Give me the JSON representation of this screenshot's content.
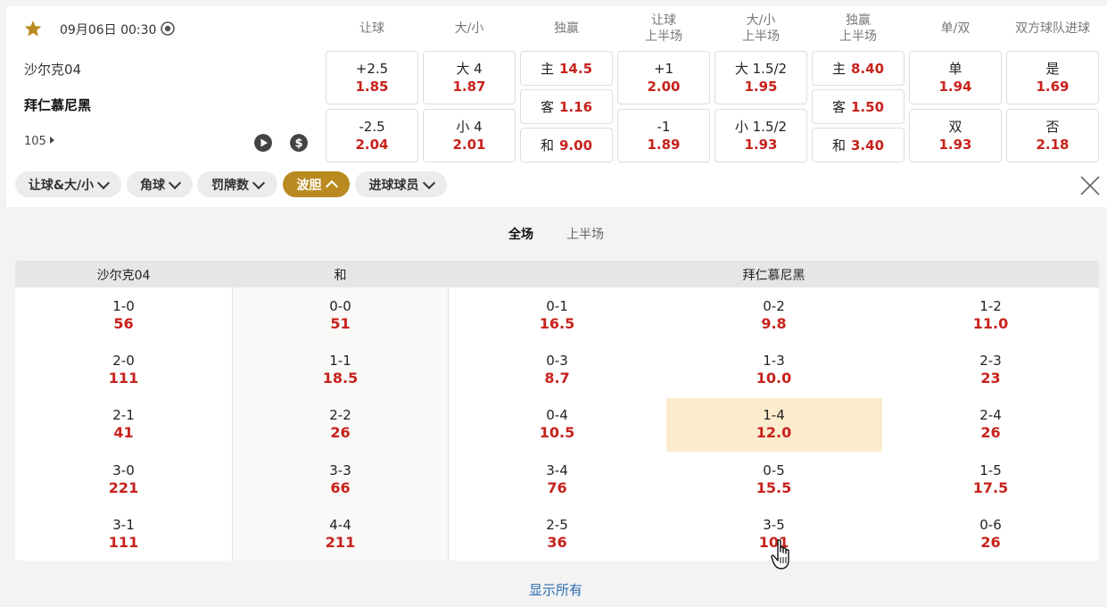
{
  "match": {
    "datetime": "09月06日 00:30",
    "home": "沙尔克04",
    "away": "拜仁慕尼黑",
    "more_count": "105"
  },
  "column_headers": [
    {
      "line1": "让球",
      "line2": ""
    },
    {
      "line1": "大/小",
      "line2": ""
    },
    {
      "line1": "独赢",
      "line2": ""
    },
    {
      "line1": "让球",
      "line2": "上半场"
    },
    {
      "line1": "大/小",
      "line2": "上半场"
    },
    {
      "line1": "独赢",
      "line2": "上半场"
    },
    {
      "line1": "单/双",
      "line2": ""
    },
    {
      "line1": "双方球队进球",
      "line2": ""
    }
  ],
  "markets": {
    "handicap": [
      {
        "label": "+2.5",
        "odds": "1.85"
      },
      {
        "label": "-2.5",
        "odds": "2.04"
      }
    ],
    "over_under": [
      {
        "label": "大 4",
        "odds": "1.87"
      },
      {
        "label": "小 4",
        "odds": "2.01"
      }
    ],
    "win": [
      {
        "label": "主",
        "odds": "14.5"
      },
      {
        "label": "客",
        "odds": "1.16"
      },
      {
        "label": "和",
        "odds": "9.00"
      }
    ],
    "handicap_1h": [
      {
        "label": "+1",
        "odds": "2.00"
      },
      {
        "label": "-1",
        "odds": "1.89"
      }
    ],
    "over_under_1h": [
      {
        "label": "大 1.5/2",
        "odds": "1.95"
      },
      {
        "label": "小 1.5/2",
        "odds": "1.93"
      }
    ],
    "win_1h": [
      {
        "label": "主",
        "odds": "8.40"
      },
      {
        "label": "客",
        "odds": "1.50"
      },
      {
        "label": "和",
        "odds": "3.40"
      }
    ],
    "odd_even": [
      {
        "label": "单",
        "odds": "1.94"
      },
      {
        "label": "双",
        "odds": "1.93"
      }
    ],
    "btts": [
      {
        "label": "是",
        "odds": "1.69"
      },
      {
        "label": "否",
        "odds": "2.18"
      }
    ]
  },
  "chips": [
    {
      "label": "让球&大/小",
      "active": false
    },
    {
      "label": "角球",
      "active": false
    },
    {
      "label": "罚牌数",
      "active": false
    },
    {
      "label": "波胆",
      "active": true
    },
    {
      "label": "进球球员",
      "active": false
    }
  ],
  "tabs": {
    "full": "全场",
    "half": "上半场"
  },
  "score_table": {
    "headers": {
      "home": "沙尔克04",
      "draw": "和",
      "away": "拜仁慕尼黑"
    },
    "home": [
      {
        "score": "1-0",
        "odds": "56"
      },
      {
        "score": "2-0",
        "odds": "111"
      },
      {
        "score": "2-1",
        "odds": "41"
      },
      {
        "score": "3-0",
        "odds": "221"
      },
      {
        "score": "3-1",
        "odds": "111"
      }
    ],
    "draw": [
      {
        "score": "0-0",
        "odds": "51"
      },
      {
        "score": "1-1",
        "odds": "18.5"
      },
      {
        "score": "2-2",
        "odds": "26"
      },
      {
        "score": "3-3",
        "odds": "66"
      },
      {
        "score": "4-4",
        "odds": "211"
      }
    ],
    "away1": [
      {
        "score": "0-1",
        "odds": "16.5"
      },
      {
        "score": "0-3",
        "odds": "8.7"
      },
      {
        "score": "0-4",
        "odds": "10.5"
      },
      {
        "score": "3-4",
        "odds": "76"
      },
      {
        "score": "2-5",
        "odds": "36"
      }
    ],
    "away2": [
      {
        "score": "0-2",
        "odds": "9.8"
      },
      {
        "score": "1-3",
        "odds": "10.0"
      },
      {
        "score": "1-4",
        "odds": "12.0"
      },
      {
        "score": "0-5",
        "odds": "15.5"
      },
      {
        "score": "3-5",
        "odds": "101"
      }
    ],
    "away3": [
      {
        "score": "1-2",
        "odds": "11.0"
      },
      {
        "score": "2-3",
        "odds": "23"
      },
      {
        "score": "2-4",
        "odds": "26"
      },
      {
        "score": "1-5",
        "odds": "17.5"
      },
      {
        "score": "0-6",
        "odds": "26"
      }
    ]
  },
  "show_all": "显示所有",
  "colors": {
    "accent": "#b98a1f",
    "odds": "#c8221c",
    "highlight": "#fbecce",
    "link": "#2b6cb0"
  }
}
